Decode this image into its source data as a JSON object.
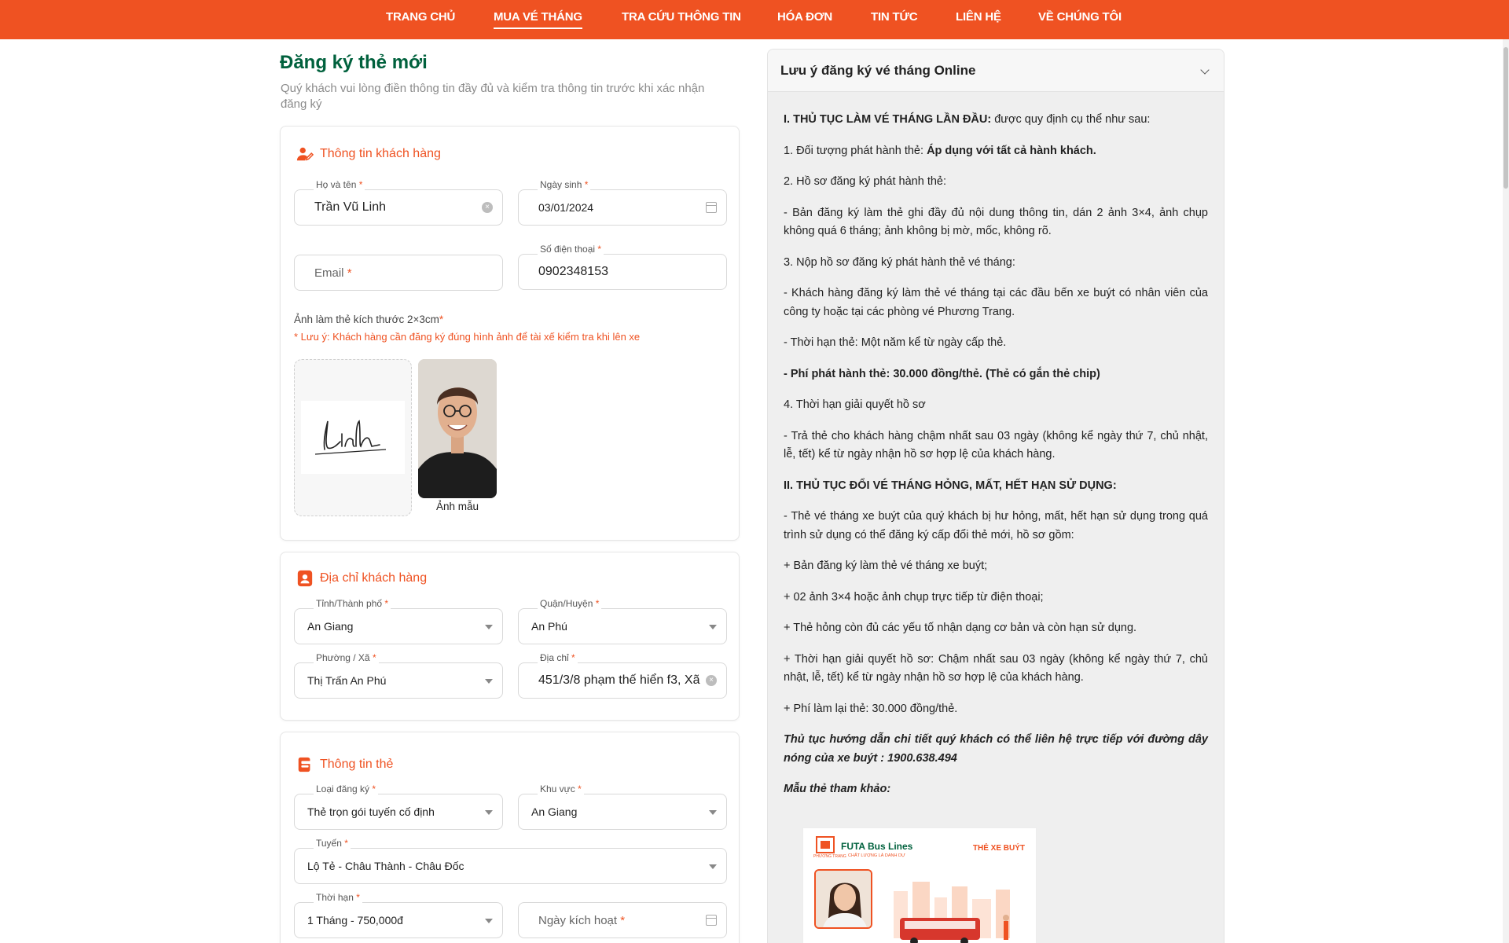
{
  "nav": {
    "items": [
      "TRANG CHỦ",
      "MUA VÉ THÁNG",
      "TRA CỨU THÔNG TIN",
      "HÓA ĐƠN",
      "TIN TỨC",
      "LIÊN HỆ",
      "VỀ CHÚNG TÔI"
    ],
    "active": "MUA VÉ THÁNG"
  },
  "form": {
    "title": "Đăng ký thẻ mới",
    "subtitle": "Quý khách vui lòng điền thông tin đầy đủ và kiểm tra thông tin trước khi xác nhận đăng ký",
    "customer": {
      "section_title": "Thông tin khách hàng",
      "name_label": "Họ và tên",
      "name_value": "Trần Vũ Linh",
      "dob_label": "Ngày sinh",
      "dob_value": "03/01/2024",
      "email_placeholder": "Email",
      "phone_label": "Số điện thoại",
      "phone_value": "0902348153",
      "photo_label": "Ảnh làm thẻ kích thước 2×3cm",
      "photo_note": "* Lưu ý: Khách hàng cần đăng ký đúng hình ảnh để tài xế kiểm tra khi lên xe",
      "signature_text": "Linh",
      "sample_caption": "Ảnh mẫu"
    },
    "address": {
      "section_title": "Địa chỉ khách hàng",
      "province_label": "Tỉnh/Thành phố",
      "province_value": "An Giang",
      "district_label": "Quận/Huyện",
      "district_value": "An Phú",
      "ward_label": "Phường / Xã",
      "ward_value": "Thị Trấn An Phú",
      "street_label": "Địa chỉ",
      "street_value": "451/3/8 phạm thế hiển f3, Xã ("
    },
    "card": {
      "section_title": "Thông tin thẻ",
      "type_label": "Loại đăng ký",
      "type_value": "Thẻ trọn gói tuyến cố định",
      "region_label": "Khu vực",
      "region_value": "An Giang",
      "route_label": "Tuyến",
      "route_value": "Lộ Tẻ - Châu Thành - Châu Đốc",
      "duration_label": "Thời hạn",
      "duration_value": "1 Tháng - 750,000đ",
      "activation_placeholder": "Ngày kích hoạt"
    }
  },
  "notice": {
    "title": "Lưu ý đăng ký vé tháng Online",
    "s1_head": "I. THỦ TỤC LÀM VÉ THÁNG LẦN ĐẦU:",
    "s1_head_tail": " được quy định cụ thể như sau:",
    "p1_a": "1. Đối tượng phát hành thẻ: ",
    "p1_b": "Áp dụng với tất cả hành khách.",
    "p2": "2. Hồ sơ đăng ký phát hành thẻ:",
    "p3": "- Bản đăng ký làm thẻ ghi đầy đủ nội dung thông tin, dán 2 ảnh 3×4, ảnh chụp không quá 6 tháng; ảnh không bị mờ, mốc, không rõ.",
    "p4": "3. Nộp hồ sơ đăng ký phát hành thẻ vé tháng:",
    "p5": "- Khách hàng đăng ký làm thẻ vé tháng tại các đầu bến xe buýt có nhân viên của công ty hoặc tại các phòng vé Phương Trang.",
    "p6": "- Thời hạn thẻ: Một năm kể từ ngày cấp thẻ.",
    "p7": "- Phí phát hành thẻ: 30.000 đồng/thẻ. (Thẻ có gắn thẻ chip)",
    "p8": "4. Thời hạn giải quyết hồ sơ",
    "p9": "- Trả thẻ cho khách hàng chậm nhất sau 03 ngày (không kể ngày thứ 7, chủ nhật, lễ, tết) kể từ ngày nhận hồ sơ hợp lệ của khách hàng.",
    "s2_head": "II. THỦ TỤC ĐỔI VÉ THÁNG HỎNG, MẤT, HẾT HẠN SỬ DỤNG:",
    "p10": "- Thẻ vé tháng xe buýt của quý khách bị hư hỏng, mất, hết hạn sử dụng trong quá trình sử dụng có thể đăng ký cấp đổi thẻ mới, hồ sơ gồm:",
    "p11": "+ Bản đăng ký làm thẻ vé tháng xe buýt;",
    "p12": "+ 02 ảnh 3×4 hoặc ảnh chụp trực tiếp từ điện thoại;",
    "p13": "+ Thẻ hỏng còn đủ các yếu tố nhận dạng cơ bản và còn hạn sử dụng.",
    "p14": "+ Thời hạn giải quyết hồ sơ: Chậm nhất sau 03 ngày (không kể ngày thứ 7, chủ nhật, lễ, tết) kể từ ngày nhận hồ sơ hợp lệ của khách hàng.",
    "p15": "+ Phí làm lại thẻ: 30.000 đồng/thẻ.",
    "p16": "Thủ tục hướng dẫn chi tiết quý khách có thể liên hệ trực tiếp với đường dây nóng của xe buýt : 1900.638.494",
    "p17": "Mẫu thẻ tham khảo:",
    "sample_brand": "FUTA Bus Lines",
    "sample_slogan": "CHẤT LƯỢNG LÀ DANH DỰ",
    "sample_type": "THẺ XE BUÝT",
    "sample_logo": "PHƯƠNG TRANG"
  },
  "colors": {
    "brand": "#ef5222",
    "title_green": "#00613d"
  }
}
